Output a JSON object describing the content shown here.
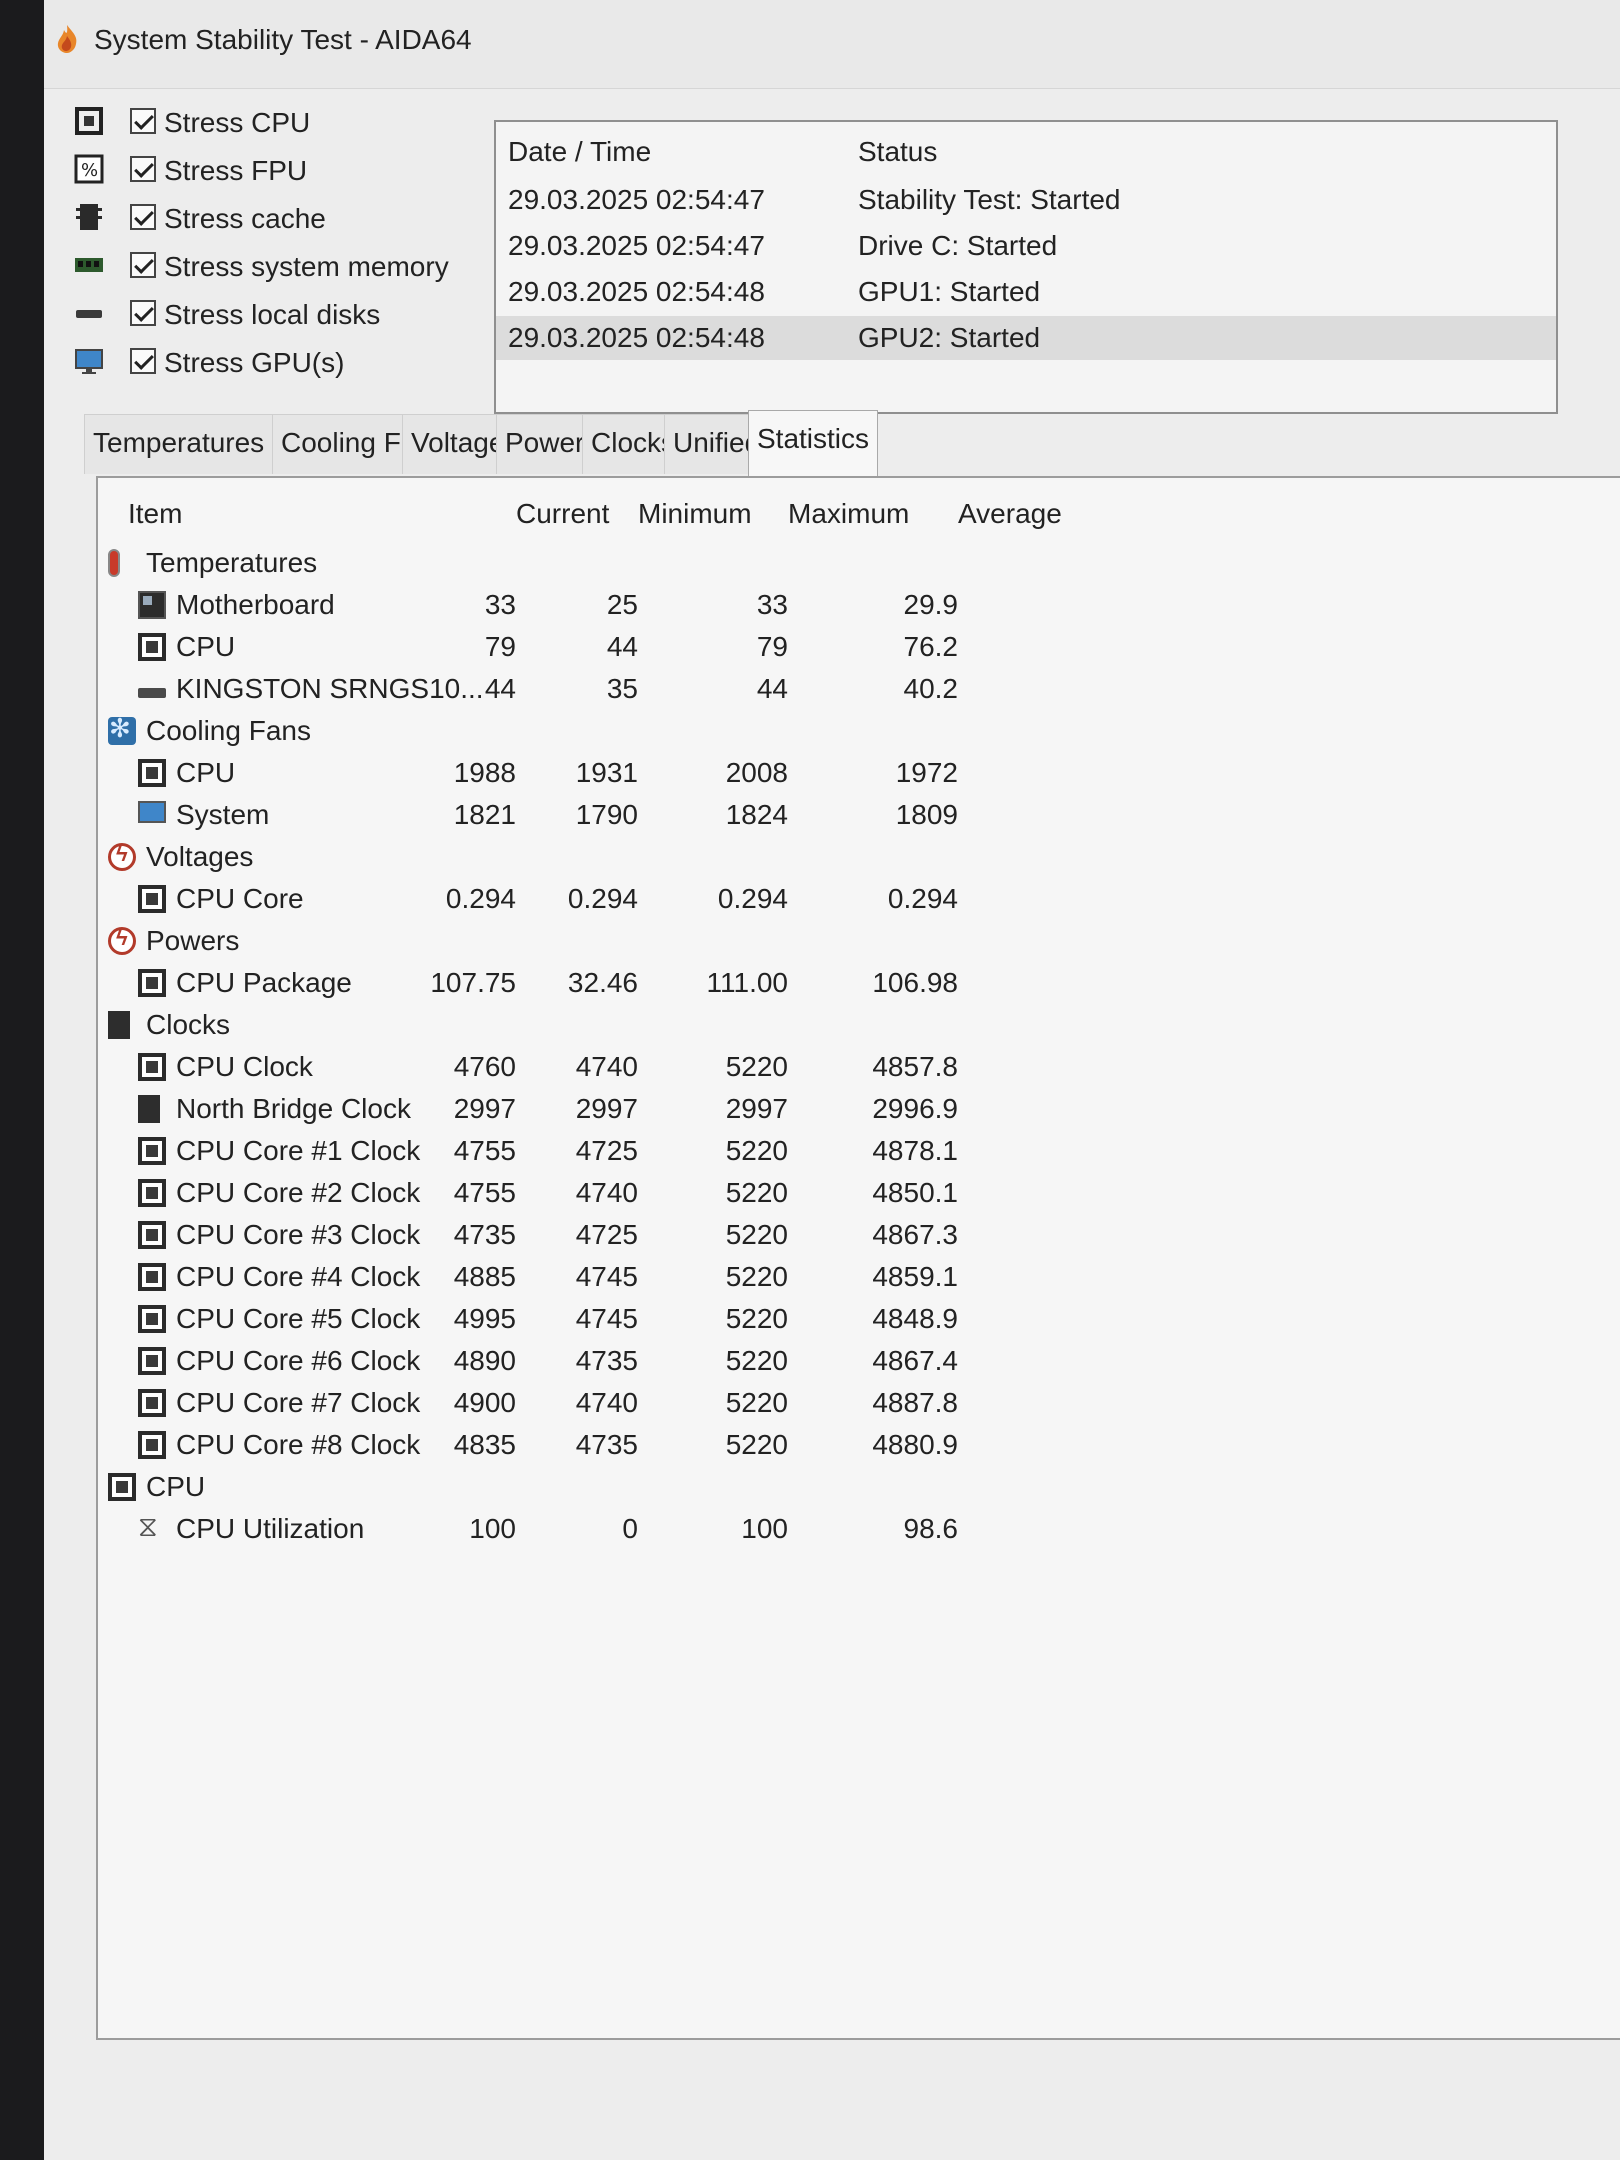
{
  "window": {
    "title": "System Stability Test - AIDA64"
  },
  "stress_options": [
    {
      "label": "Stress CPU",
      "checked": true,
      "icon": "cpu-chip-icon"
    },
    {
      "label": "Stress FPU",
      "checked": true,
      "icon": "fpu-icon"
    },
    {
      "label": "Stress cache",
      "checked": true,
      "icon": "cache-icon"
    },
    {
      "label": "Stress system memory",
      "checked": true,
      "icon": "memory-icon"
    },
    {
      "label": "Stress local disks",
      "checked": true,
      "icon": "disk-icon"
    },
    {
      "label": "Stress GPU(s)",
      "checked": true,
      "icon": "gpu-monitor-icon"
    }
  ],
  "log": {
    "headers": {
      "datetime": "Date / Time",
      "status": "Status"
    },
    "rows": [
      {
        "datetime": "29.03.2025 02:54:47",
        "status": "Stability Test: Started"
      },
      {
        "datetime": "29.03.2025 02:54:47",
        "status": "Drive C: Started"
      },
      {
        "datetime": "29.03.2025 02:54:48",
        "status": "GPU1: Started"
      },
      {
        "datetime": "29.03.2025 02:54:48",
        "status": "GPU2: Started"
      }
    ]
  },
  "tabs": [
    "Temperatures",
    "Cooling Fans",
    "Voltages",
    "Powers",
    "Clocks",
    "Unified",
    "Statistics"
  ],
  "active_tab": "Statistics",
  "stats": {
    "columns": {
      "item": "Item",
      "current": "Current",
      "minimum": "Minimum",
      "maximum": "Maximum",
      "average": "Average"
    },
    "rows": [
      {
        "level": 0,
        "icon": "thermometer-icon",
        "name": "Temperatures",
        "current": "",
        "minimum": "",
        "maximum": "",
        "average": ""
      },
      {
        "level": 1,
        "icon": "motherboard-icon",
        "name": "Motherboard",
        "current": "33",
        "minimum": "25",
        "maximum": "33",
        "average": "29.9"
      },
      {
        "level": 1,
        "icon": "cpu-chip-icon",
        "name": "CPU",
        "current": "79",
        "minimum": "44",
        "maximum": "79",
        "average": "76.2"
      },
      {
        "level": 1,
        "icon": "disk-icon",
        "name": "KINGSTON SRNGS10...",
        "current": "44",
        "minimum": "35",
        "maximum": "44",
        "average": "40.2"
      },
      {
        "level": 0,
        "icon": "fan-icon",
        "name": "Cooling Fans",
        "current": "",
        "minimum": "",
        "maximum": "",
        "average": ""
      },
      {
        "level": 1,
        "icon": "cpu-chip-icon",
        "name": "CPU",
        "current": "1988",
        "minimum": "1931",
        "maximum": "2008",
        "average": "1972"
      },
      {
        "level": 1,
        "icon": "monitor-icon",
        "name": "System",
        "current": "1821",
        "minimum": "1790",
        "maximum": "1824",
        "average": "1809"
      },
      {
        "level": 0,
        "icon": "voltage-icon",
        "name": "Voltages",
        "current": "",
        "minimum": "",
        "maximum": "",
        "average": ""
      },
      {
        "level": 1,
        "icon": "cpu-chip-icon",
        "name": "CPU Core",
        "current": "0.294",
        "minimum": "0.294",
        "maximum": "0.294",
        "average": "0.294"
      },
      {
        "level": 0,
        "icon": "power-icon",
        "name": "Powers",
        "current": "",
        "minimum": "",
        "maximum": "",
        "average": ""
      },
      {
        "level": 1,
        "icon": "cpu-chip-icon",
        "name": "CPU Package",
        "current": "107.75",
        "minimum": "32.46",
        "maximum": "111.00",
        "average": "106.98"
      },
      {
        "level": 0,
        "icon": "clock-icon",
        "name": "Clocks",
        "current": "",
        "minimum": "",
        "maximum": "",
        "average": ""
      },
      {
        "level": 1,
        "icon": "cpu-chip-icon",
        "name": "CPU Clock",
        "current": "4760",
        "minimum": "4740",
        "maximum": "5220",
        "average": "4857.8"
      },
      {
        "level": 1,
        "icon": "north-bridge-icon",
        "name": "North Bridge Clock",
        "current": "2997",
        "minimum": "2997",
        "maximum": "2997",
        "average": "2996.9"
      },
      {
        "level": 1,
        "icon": "cpu-chip-icon",
        "name": "CPU Core #1 Clock",
        "current": "4755",
        "minimum": "4725",
        "maximum": "5220",
        "average": "4878.1"
      },
      {
        "level": 1,
        "icon": "cpu-chip-icon",
        "name": "CPU Core #2 Clock",
        "current": "4755",
        "minimum": "4740",
        "maximum": "5220",
        "average": "4850.1"
      },
      {
        "level": 1,
        "icon": "cpu-chip-icon",
        "name": "CPU Core #3 Clock",
        "current": "4735",
        "minimum": "4725",
        "maximum": "5220",
        "average": "4867.3"
      },
      {
        "level": 1,
        "icon": "cpu-chip-icon",
        "name": "CPU Core #4 Clock",
        "current": "4885",
        "minimum": "4745",
        "maximum": "5220",
        "average": "4859.1"
      },
      {
        "level": 1,
        "icon": "cpu-chip-icon",
        "name": "CPU Core #5 Clock",
        "current": "4995",
        "minimum": "4745",
        "maximum": "5220",
        "average": "4848.9"
      },
      {
        "level": 1,
        "icon": "cpu-chip-icon",
        "name": "CPU Core #6 Clock",
        "current": "4890",
        "minimum": "4735",
        "maximum": "5220",
        "average": "4867.4"
      },
      {
        "level": 1,
        "icon": "cpu-chip-icon",
        "name": "CPU Core #7 Clock",
        "current": "4900",
        "minimum": "4740",
        "maximum": "5220",
        "average": "4887.8"
      },
      {
        "level": 1,
        "icon": "cpu-chip-icon",
        "name": "CPU Core #8 Clock",
        "current": "4835",
        "minimum": "4735",
        "maximum": "5220",
        "average": "4880.9"
      },
      {
        "level": 0,
        "icon": "cpu-chip-icon",
        "name": "CPU",
        "current": "",
        "minimum": "",
        "maximum": "",
        "average": ""
      },
      {
        "level": 1,
        "icon": "hourglass-icon",
        "name": "CPU Utilization",
        "current": "100",
        "minimum": "0",
        "maximum": "100",
        "average": "98.6"
      }
    ]
  }
}
